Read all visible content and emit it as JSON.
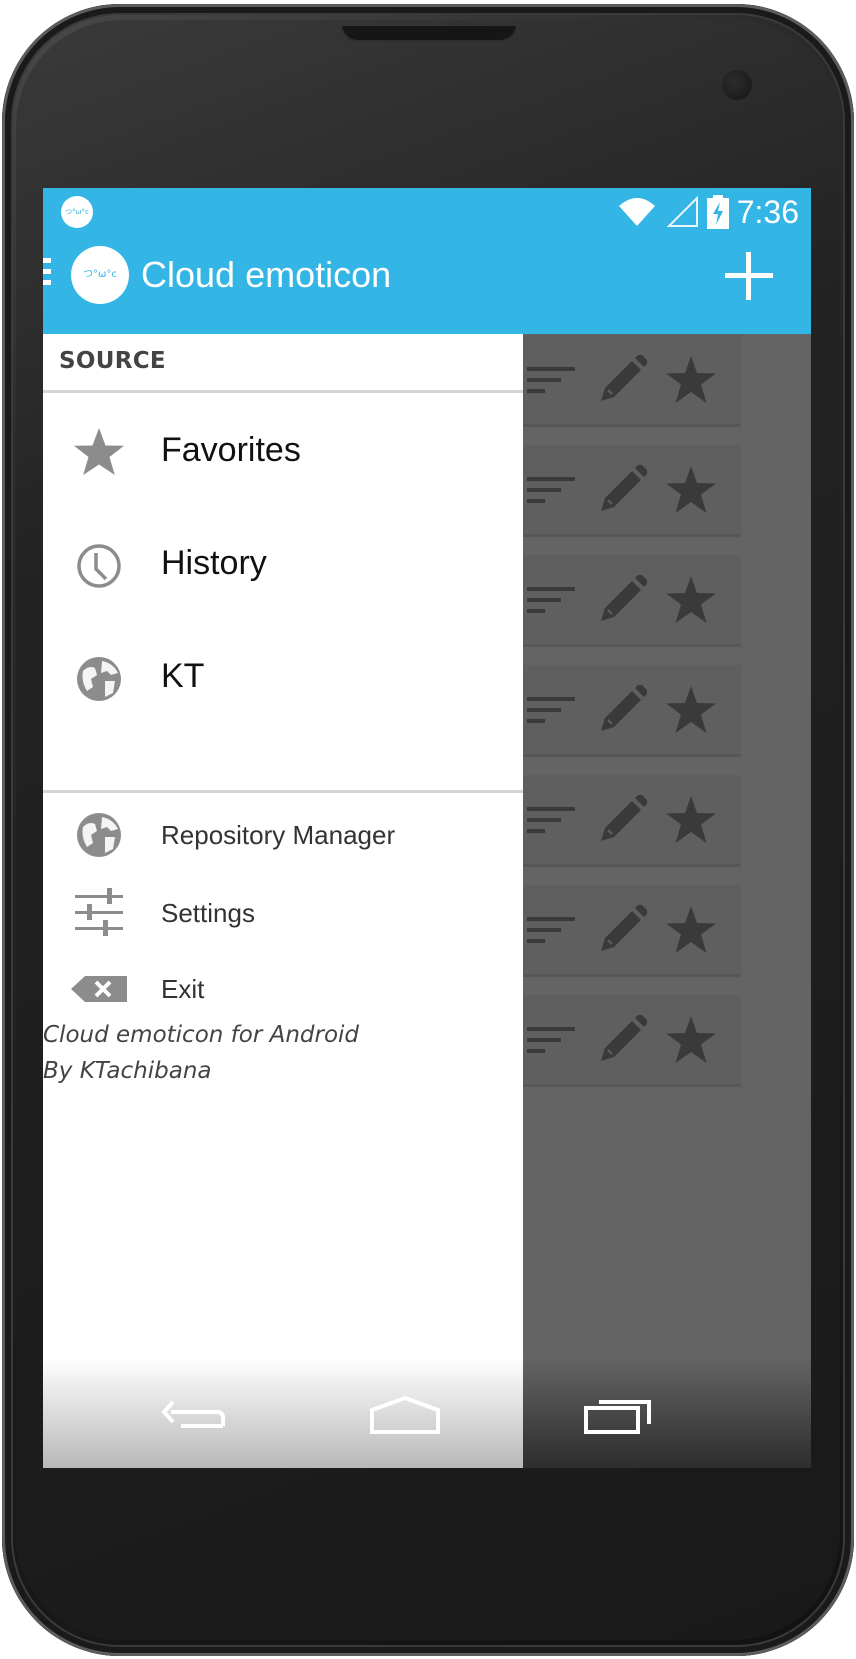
{
  "status_bar": {
    "time": "7:36"
  },
  "action_bar": {
    "title": "Cloud emoticon",
    "logo_text": "つ°ω°c"
  },
  "drawer": {
    "section_header": "SOURCE",
    "sources": [
      {
        "label": "Favorites",
        "icon": "star-icon"
      },
      {
        "label": "History",
        "icon": "clock-icon"
      },
      {
        "label": "KT",
        "icon": "globe-icon"
      }
    ],
    "menu": [
      {
        "label": "Repository Manager",
        "icon": "globe-icon"
      },
      {
        "label": "Settings",
        "icon": "sliders-icon"
      },
      {
        "label": "Exit",
        "icon": "backspace-icon"
      }
    ],
    "footer_line1": "Cloud emoticon for Android",
    "footer_line2": "By KTachibana"
  },
  "content": {
    "row_count": 7,
    "row_actions": [
      "sort-lines-icon",
      "edit-pencil-icon",
      "favorite-star-icon"
    ],
    "partial_text": "/)"
  },
  "colors": {
    "accent": "#33b5e5",
    "drawer_bg": "#ffffff",
    "scrim": "#646464"
  }
}
